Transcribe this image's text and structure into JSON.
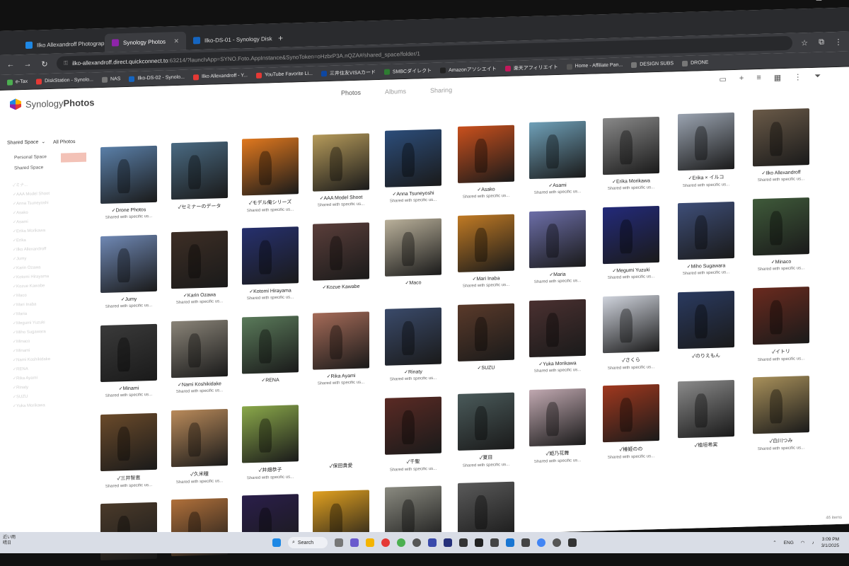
{
  "browser": {
    "tabs": [
      {
        "label": "Ilko Allexandroff Photography",
        "color": "#1e88e5"
      },
      {
        "label": "Synology Photos",
        "color": "#8e24aa",
        "active": true
      },
      {
        "label": "Ilko-DS-01 - Synology DiskSta",
        "color": "#1565c0"
      }
    ],
    "new_tab": "+",
    "url_host": "ilko-allexandroff.direct.quickconnect.to",
    "url_rest": ":63214/?launchApp=SYNO.Foto.AppInstance&SynoToken=oHzbrP3A.nQZA#/shared_space/folder/1",
    "bookmarks": [
      {
        "label": "e-Tax",
        "color": "#4caf50"
      },
      {
        "label": "DiskStation - Synolo...",
        "color": "#e53935"
      },
      {
        "label": "NAS",
        "color": "#777"
      },
      {
        "label": "Ilko-DS-02 - Synolo...",
        "color": "#1565c0"
      },
      {
        "label": "Ilko Allexandroff - Y...",
        "color": "#e53935"
      },
      {
        "label": "YouTube Favorite Li...",
        "color": "#e53935"
      },
      {
        "label": "三井住友VISAカード",
        "color": "#0d47a1"
      },
      {
        "label": "SMBCダイレクト",
        "color": "#2e7d32"
      },
      {
        "label": "Amazonアソシエイト",
        "color": "#222"
      },
      {
        "label": "楽天アフィリエイト",
        "color": "#c2185b"
      },
      {
        "label": "Home - Affiliate Pan...",
        "color": "#555"
      },
      {
        "label": "DESIGN SUBS",
        "color": "#777"
      },
      {
        "label": "DRONE",
        "color": "#777"
      }
    ]
  },
  "app": {
    "logo_a": "Synology",
    "logo_b": "Photos",
    "tabs": [
      "Photos",
      "Albums",
      "Sharing"
    ],
    "sidebar": {
      "head": "Shared Space",
      "items": [
        "Personal Space",
        "Shared Space"
      ],
      "faint": [
        "✓ミナ...",
        "✓AAA Model Shoot",
        "✓Anna Tsuneyoshi",
        "✓Asako",
        "✓Asami",
        "✓Erika Morikawa",
        "✓Erika",
        "✓Ilko Allexandroff",
        "✓Jumy",
        "✓Karin Ozawa",
        "✓Kotomi Hirayama",
        "✓Kozue Kawabe",
        "✓Maco",
        "✓Mari Inaba",
        "✓Maria",
        "✓Megumi Yuzuki",
        "✓Miho Sugawara",
        "✓Minaco",
        "✓Minami",
        "✓Nami Koshikidake",
        "✓RENA",
        "✓Rika Ayami",
        "✓Rinaty",
        "✓SUZU",
        "✓Yuka Morikawa"
      ]
    },
    "all_photos": "All Photos",
    "shared_sub": "Shared with specific us...",
    "item_count": "46 items",
    "albums": [
      {
        "name": "✓Drone Photos",
        "shared": true,
        "color": "#5a7fa8"
      },
      {
        "name": "✓セミナーのデータ",
        "shared": false,
        "color": "#4a6a82"
      },
      {
        "name": "✓モデル俺シリーズ",
        "shared": true,
        "color": "#e0781e"
      },
      {
        "name": "✓AAA Model Shoot",
        "shared": true,
        "color": "#b59a5a"
      },
      {
        "name": "✓Anna Tsuneyoshi",
        "shared": true,
        "color": "#2c4d7a"
      },
      {
        "name": "✓Asako",
        "shared": true,
        "color": "#c9501d"
      },
      {
        "name": "✓Asami",
        "shared": true,
        "color": "#6fa0b8"
      },
      {
        "name": "✓Erika Morikawa",
        "shared": true,
        "color": "#888888"
      },
      {
        "name": "✓Erika × イルコ",
        "shared": true,
        "color": "#9aa3b0"
      },
      {
        "name": "✓Ilko Allexandroff",
        "shared": true,
        "color": "#6a5a48"
      },
      {
        "name": "✓Jumy",
        "shared": true,
        "color": "#6f88b4"
      },
      {
        "name": "✓Karin Ozawa",
        "shared": true,
        "color": "#3d2e25"
      },
      {
        "name": "✓Kotomi Hirayama",
        "shared": true,
        "color": "#26306e"
      },
      {
        "name": "✓Kozue Kawabe",
        "shared": false,
        "color": "#5a3e3a"
      },
      {
        "name": "✓Maco",
        "shared": false,
        "color": "#b9b09a"
      },
      {
        "name": "✓Mari Inaba",
        "shared": true,
        "color": "#c07a24"
      },
      {
        "name": "✓Maria",
        "shared": true,
        "color": "#6c6ea8"
      },
      {
        "name": "✓Megumi Yuzuki",
        "shared": true,
        "color": "#232a7a"
      },
      {
        "name": "✓Miho Sugawara",
        "shared": true,
        "color": "#3e4e78"
      },
      {
        "name": "✓Minaco",
        "shared": true,
        "color": "#3f5a3a"
      },
      {
        "name": "✓Minami",
        "shared": true,
        "color": "#3a3a3a"
      },
      {
        "name": "✓Nami Koshikidake",
        "shared": true,
        "color": "#8a8478"
      },
      {
        "name": "✓RENA",
        "shared": false,
        "color": "#5a7a5a"
      },
      {
        "name": "✓Rika Ayami",
        "shared": true,
        "color": "#a56b58"
      },
      {
        "name": "✓Rinaty",
        "shared": true,
        "color": "#3a4a6a"
      },
      {
        "name": "✓SUZU",
        "shared": false,
        "color": "#5a3a2a"
      },
      {
        "name": "✓Yuka Morikawa",
        "shared": true,
        "color": "#4a3030"
      },
      {
        "name": "✓さくら",
        "shared": true,
        "color": "#cfd3dc"
      },
      {
        "name": "✓のりえもん",
        "shared": false,
        "color": "#2a3a60"
      },
      {
        "name": "✓イトリ",
        "shared": true,
        "color": "#6a2a1e"
      },
      {
        "name": "✓三井智恵",
        "shared": true,
        "color": "#6a4a2a"
      },
      {
        "name": "✓久米瞳",
        "shared": true,
        "color": "#b98a5a"
      },
      {
        "name": "✓井畑恭子",
        "shared": true,
        "color": "#8aa84a"
      },
      {
        "name": "✓保田貴愛",
        "shared": false,
        "color": ""
      },
      {
        "name": "✓千聖",
        "shared": true,
        "color": "#5a2a24"
      },
      {
        "name": "✓夏目",
        "shared": true,
        "color": "#4a5a5a"
      },
      {
        "name": "✓姫乃花舞",
        "shared": true,
        "color": "#c0a8b0"
      },
      {
        "name": "✓椿姫のの",
        "shared": true,
        "color": "#a0381e"
      },
      {
        "name": "✓植垣希実",
        "shared": false,
        "color": "#8a8a8a"
      },
      {
        "name": "✓白川つみ",
        "shared": true,
        "color": "#a8905a"
      },
      {
        "name": "",
        "shared": false,
        "color": "#4a3a2a"
      },
      {
        "name": "",
        "shared": false,
        "color": "#b0703a"
      },
      {
        "name": "",
        "shared": false,
        "color": "#2a1e4a"
      },
      {
        "name": "",
        "shared": false,
        "color": "#e0a020"
      },
      {
        "name": "",
        "shared": false,
        "color": "#8a8a80"
      },
      {
        "name": "",
        "shared": false,
        "color": "#5a5a5a"
      }
    ]
  },
  "taskbar": {
    "search": "Search",
    "lang": "ENG",
    "time": "3:09 PM",
    "date": "3/1/2025",
    "left_a": "近い雨",
    "left_b": "晴日"
  }
}
